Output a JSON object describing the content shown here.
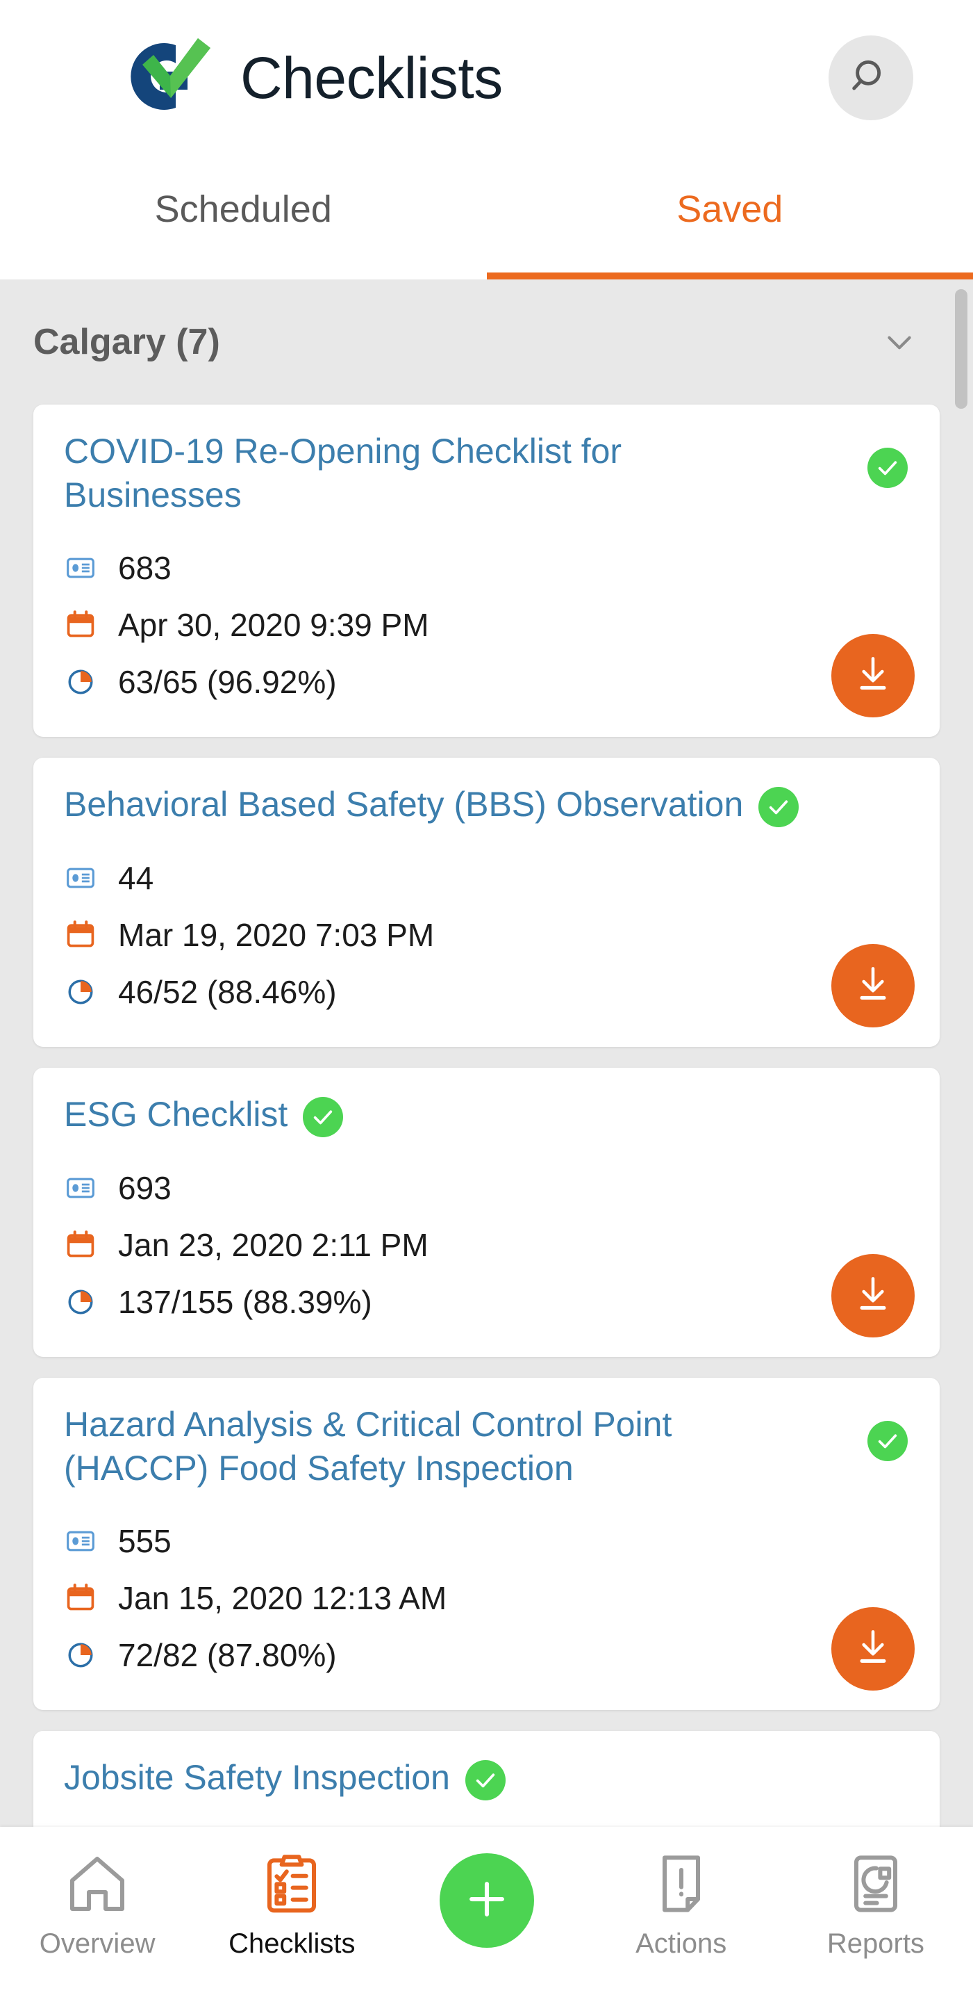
{
  "header": {
    "title": "Checklists",
    "logo_name": "checklist-app-logo",
    "logo_colors": {
      "ring": "#14457B",
      "check": "#4CAF36"
    },
    "search_icon": "search-icon"
  },
  "tabs": [
    {
      "label": "Scheduled",
      "active": false
    },
    {
      "label": "Saved",
      "active": true
    }
  ],
  "group": {
    "label": "Calgary (7)",
    "chevron_icon": "chevron-down-icon",
    "expanded": true
  },
  "colors": {
    "accent_orange": "#EC6A1F",
    "download_orange": "#E8651F",
    "title_blue": "#3C7EAD",
    "success_green": "#4CD452",
    "background_gray": "#E8E8E8"
  },
  "cards": [
    {
      "title": "COVID-19 Re-Opening Checklist for Businesses",
      "status_icon": "green-check-badge",
      "id_icon": "id-card-icon",
      "id": "683",
      "date_icon": "calendar-icon",
      "date": "Apr 30, 2020 9:39 PM",
      "progress_icon": "pie-chart-icon",
      "progress": "63/65 (96.92%)",
      "download_icon": "download-icon",
      "two_line_title": true
    },
    {
      "title": "Behavioral Based Safety (BBS) Observation",
      "status_icon": "green-check-badge",
      "id_icon": "id-card-icon",
      "id": "44",
      "date_icon": "calendar-icon",
      "date": "Mar 19, 2020 7:03 PM",
      "progress_icon": "pie-chart-icon",
      "progress": "46/52 (88.46%)",
      "download_icon": "download-icon",
      "two_line_title": false
    },
    {
      "title": "ESG Checklist",
      "status_icon": "green-check-badge",
      "id_icon": "id-card-icon",
      "id": "693",
      "date_icon": "calendar-icon",
      "date": "Jan 23, 2020 2:11 PM",
      "progress_icon": "pie-chart-icon",
      "progress": "137/155 (88.39%)",
      "download_icon": "download-icon",
      "two_line_title": false
    },
    {
      "title": "Hazard Analysis & Critical Control Point (HACCP) Food Safety Inspection",
      "status_icon": "green-check-badge",
      "id_icon": "id-card-icon",
      "id": "555",
      "date_icon": "calendar-icon",
      "date": "Jan 15, 2020 12:13 AM",
      "progress_icon": "pie-chart-icon",
      "progress": "72/82 (87.80%)",
      "download_icon": "download-icon",
      "two_line_title": true
    },
    {
      "title": "Jobsite Safety Inspection",
      "status_icon": "green-check-badge",
      "partial": true
    }
  ],
  "bottom_nav": [
    {
      "label": "Overview",
      "icon": "home-icon",
      "active": false
    },
    {
      "label": "Checklists",
      "icon": "clipboard-checklist-icon",
      "active": true
    },
    {
      "label": "",
      "icon": "plus-icon",
      "active": false,
      "is_fab": true
    },
    {
      "label": "Actions",
      "icon": "document-alert-icon",
      "active": false
    },
    {
      "label": "Reports",
      "icon": "document-chart-icon",
      "active": false
    }
  ]
}
